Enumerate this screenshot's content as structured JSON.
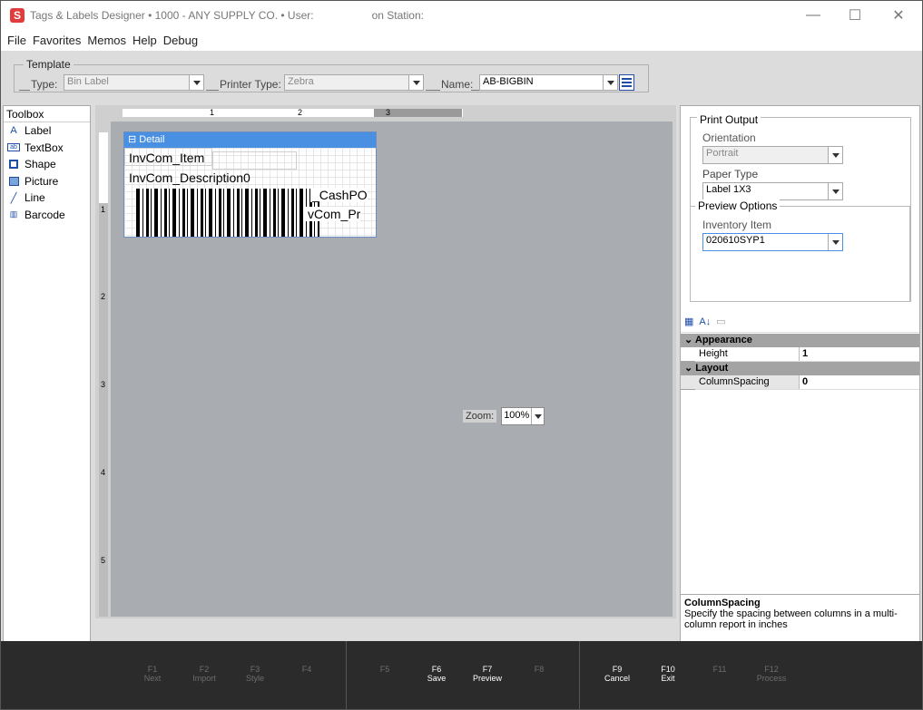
{
  "title": {
    "app_name": "Tags & Labels Designer",
    "company": "•   1000 - ANY SUPPLY CO.   •   User:",
    "station": "on Station:"
  },
  "menu": [
    "File",
    "Favorites",
    "Memos",
    "Help",
    "Debug"
  ],
  "template": {
    "legend": "Template",
    "type_label": "Type:",
    "type_value": "Bin Label",
    "printer_label": "Printer Type:",
    "printer_value": "Zebra",
    "name_label": "Name:",
    "name_value": "AB-BIGBIN"
  },
  "toolbox": {
    "header": "Toolbox",
    "items": [
      {
        "label": "Label",
        "icon": "label-icon"
      },
      {
        "label": "TextBox",
        "icon": "textbox-icon"
      },
      {
        "label": "Shape",
        "icon": "shape-icon"
      },
      {
        "label": "Picture",
        "icon": "picture-icon"
      },
      {
        "label": "Line",
        "icon": "line-icon"
      },
      {
        "label": "Barcode",
        "icon": "barcode-icon"
      }
    ]
  },
  "designer": {
    "band_label": "Detail",
    "fields": [
      "InvCom_Item",
      "InvCom_Description0",
      "_CashPO",
      "vCom_Pr"
    ],
    "ruler_top": [
      "1",
      "2",
      "3"
    ],
    "ruler_left": [
      "1",
      "2",
      "3",
      "4",
      "5"
    ],
    "zoom_label": "Zoom:",
    "zoom_value": "100%"
  },
  "print_output": {
    "title": "Print Output",
    "orientation_label": "Orientation",
    "orientation_value": "Portrait",
    "paper_label": "Paper Type",
    "paper_value": "Label 1X3",
    "preview_title": "Preview Options",
    "inventory_label": "Inventory Item",
    "inventory_value": "020610SYP1"
  },
  "properties": {
    "categories": [
      {
        "name": "Appearance",
        "rows": [
          {
            "name": "Height",
            "value": "1"
          }
        ]
      },
      {
        "name": "Layout",
        "rows": [
          {
            "name": "ColumnSpacing",
            "value": "0"
          }
        ]
      }
    ],
    "desc_title": "ColumnSpacing",
    "desc_text": "Specify the spacing between columns in a multi-column report in inches"
  },
  "fkeys": [
    {
      "key": "F1",
      "label": "Next",
      "active": false
    },
    {
      "key": "F2",
      "label": "Import",
      "active": false
    },
    {
      "key": "F3",
      "label": "Style",
      "active": false
    },
    {
      "key": "F4",
      "label": "",
      "active": false
    },
    {
      "key": "F5",
      "label": "",
      "active": false
    },
    {
      "key": "F6",
      "label": "Save",
      "active": true
    },
    {
      "key": "F7",
      "label": "Preview",
      "active": true
    },
    {
      "key": "F8",
      "label": "",
      "active": false
    },
    {
      "key": "F9",
      "label": "Cancel",
      "active": true
    },
    {
      "key": "F10",
      "label": "Exit",
      "active": true
    },
    {
      "key": "F11",
      "label": "",
      "active": false
    },
    {
      "key": "F12",
      "label": "Process",
      "active": false
    }
  ]
}
